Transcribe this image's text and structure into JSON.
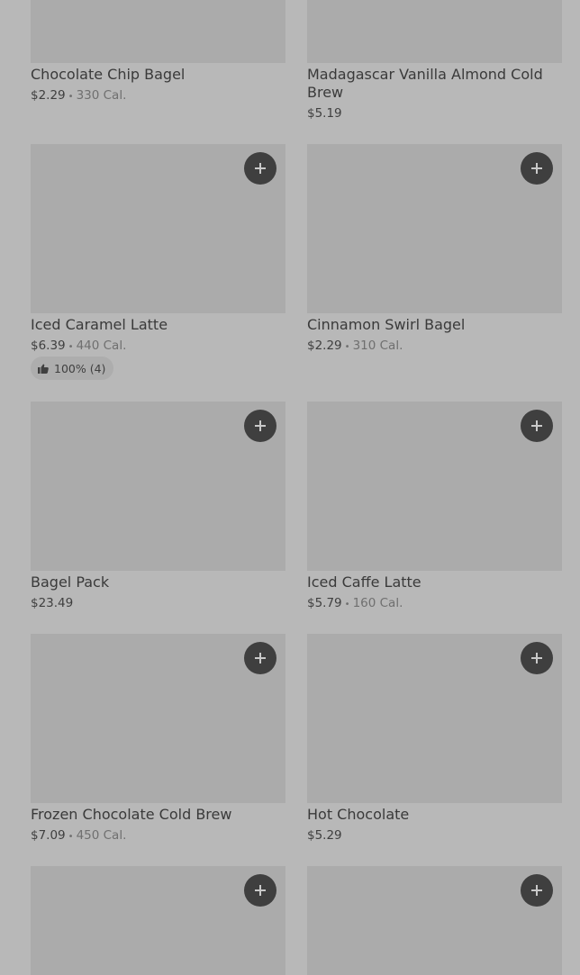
{
  "items": [
    {
      "name": "Chocolate Chip Bagel",
      "price": "$2.29",
      "calories": "330 Cal.",
      "add_label": "+"
    },
    {
      "name": "Madagascar Vanilla Almond Cold Brew",
      "price": "$5.19",
      "add_label": "+"
    },
    {
      "name": "Iced Caramel Latte",
      "price": "$6.39",
      "calories": "440 Cal.",
      "rating": "100% (4)",
      "add_label": "+"
    },
    {
      "name": "Cinnamon Swirl Bagel",
      "price": "$2.29",
      "calories": "310 Cal.",
      "add_label": "+"
    },
    {
      "name": "Bagel Pack",
      "price": "$23.49",
      "add_label": "+"
    },
    {
      "name": "Iced Caffe Latte",
      "price": "$5.79",
      "calories": "160 Cal.",
      "add_label": "+"
    },
    {
      "name": "Frozen Chocolate Cold Brew",
      "price": "$7.09",
      "calories": "450 Cal.",
      "add_label": "+"
    },
    {
      "name": "Hot Chocolate",
      "price": "$5.29",
      "add_label": "+"
    }
  ],
  "separator": "•"
}
